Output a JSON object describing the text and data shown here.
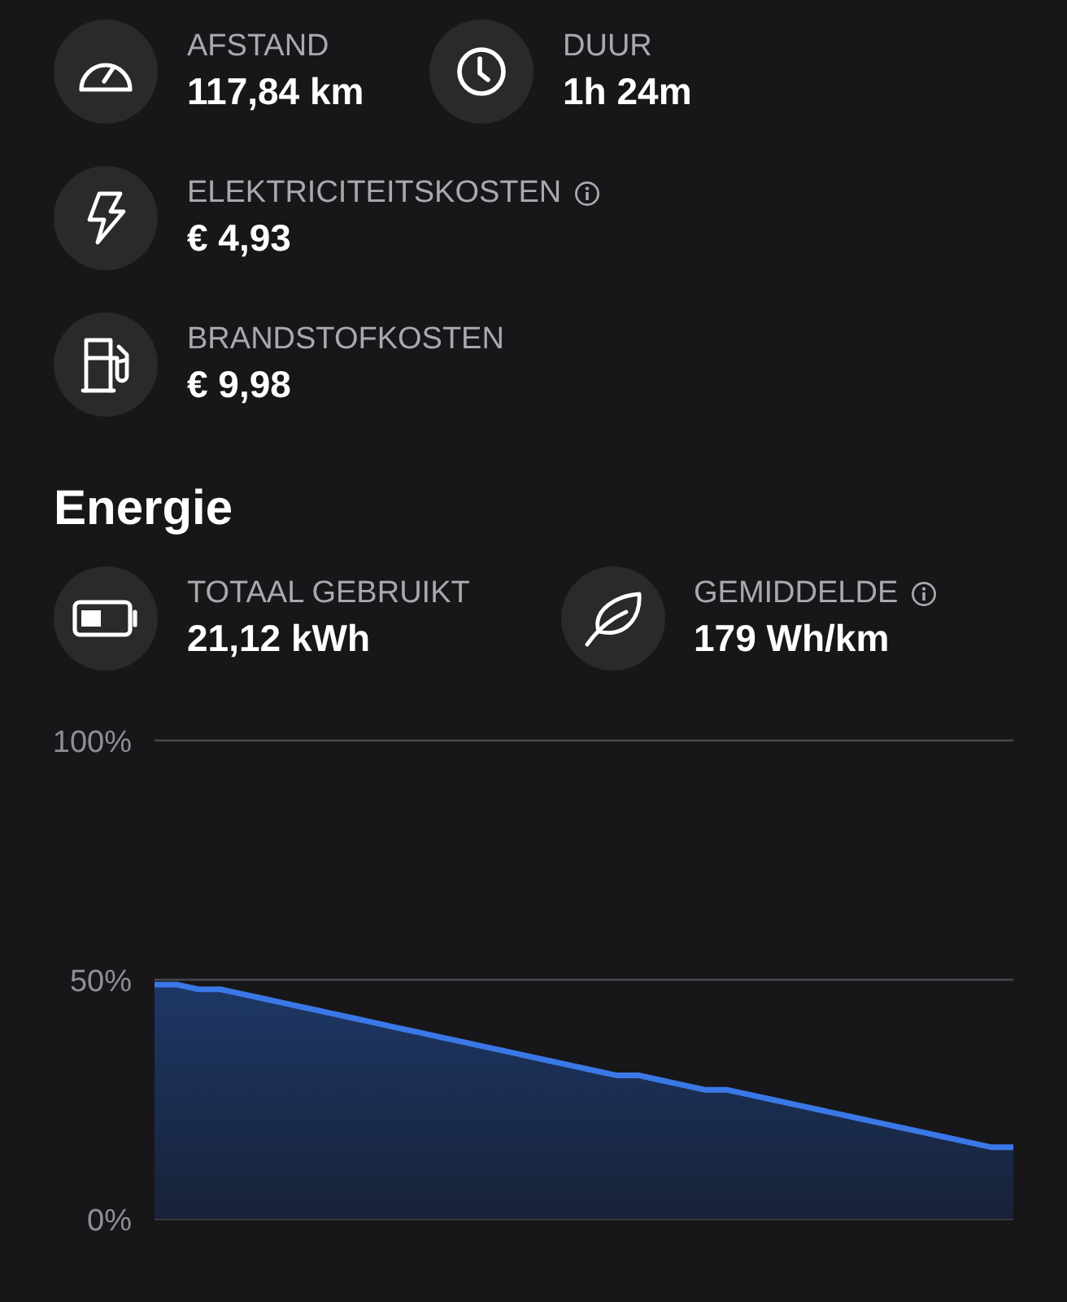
{
  "trip_stats": [
    [
      {
        "kind": "speedometer",
        "label": "AFSTAND",
        "value": "117,84 km",
        "info": false
      },
      {
        "kind": "clock",
        "label": "DUUR",
        "value": "1h 24m",
        "info": false
      }
    ],
    [
      {
        "kind": "bolt",
        "label": "ELEKTRICITEITSKOSTEN",
        "value": "€ 4,93",
        "info": true
      }
    ],
    [
      {
        "kind": "fuel",
        "label": "BRANDSTOFKOSTEN",
        "value": "€ 9,98",
        "info": false
      }
    ]
  ],
  "energy": {
    "title": "Energie",
    "stats": [
      {
        "kind": "battery",
        "label": "TOTAAL GEBRUIKT",
        "value": "21,12 kWh",
        "info": false
      },
      {
        "kind": "leaf",
        "label": "GEMIDDELDE",
        "value": "179 Wh/km",
        "info": true
      }
    ],
    "chart_data": {
      "type": "area",
      "ylim": [
        0,
        100
      ],
      "yticks": [
        {
          "value": 0,
          "label": "0%"
        },
        {
          "value": 50,
          "label": "50%"
        },
        {
          "value": 100,
          "label": "100%"
        }
      ],
      "series": [
        {
          "color": "#3b78e7",
          "values": [
            49,
            49,
            48,
            48,
            47,
            46,
            45,
            44,
            43,
            42,
            41,
            40,
            39,
            38,
            37,
            36,
            35,
            34,
            33,
            32,
            31,
            30,
            30,
            29,
            28,
            27,
            27,
            26,
            25,
            24,
            23,
            22,
            21,
            20,
            19,
            18,
            17,
            16,
            15,
            15
          ]
        }
      ]
    }
  }
}
